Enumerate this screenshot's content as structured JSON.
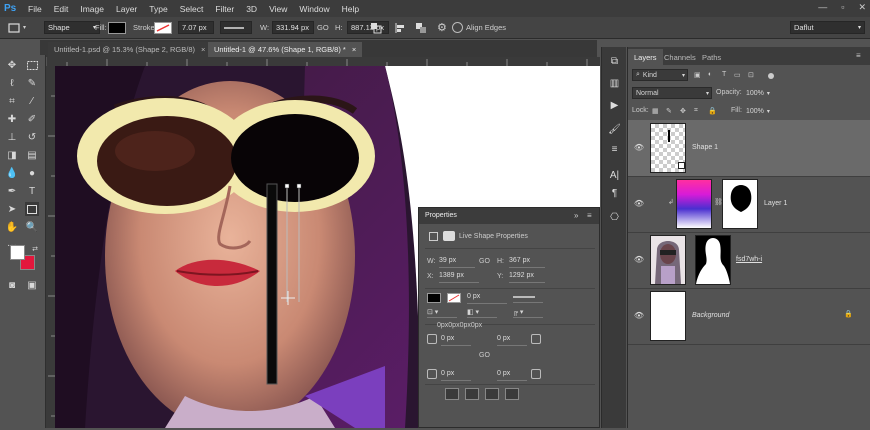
{
  "menu": {
    "logo": "Ps",
    "items": [
      "File",
      "Edit",
      "Image",
      "Layer",
      "Type",
      "Select",
      "Filter",
      "3D",
      "View",
      "Window",
      "Help"
    ],
    "window_controls": [
      "—",
      "▫",
      "✕"
    ]
  },
  "options_bar": {
    "mode": "Shape",
    "fill_label": "Fill:",
    "stroke_label": "Stroke:",
    "stroke_width": "7.07 px",
    "w_label": "W:",
    "w_value": "331.94 px",
    "link_icon": "GO",
    "h_label": "H:",
    "h_value": "887.13 px",
    "align_edges": "Align Edges",
    "workspace": "Daflut",
    "fill_color": "#000000",
    "stroke_color": "#ffffff"
  },
  "tabs": [
    {
      "label": "Untitled-1.psd @ 15.3% (Shape 2, RGB/8)",
      "close": "×"
    },
    {
      "label": "Untitled-1 @ 47.6% (Shape 1, RGB/8) *",
      "close": "×"
    }
  ],
  "panels": {
    "tabs": [
      "Layers",
      "Channels",
      "Paths"
    ],
    "kind": "Kind",
    "blend_mode": "Normal",
    "opacity_label": "Opacity:",
    "opacity": "100%",
    "lock_label": "Lock:",
    "fill_label": "Fill:",
    "fill": "100%"
  },
  "layers": [
    {
      "name": "Shape 1"
    },
    {
      "name": "Layer 1"
    },
    {
      "name": "fsd7wh-i"
    },
    {
      "name": "Background"
    }
  ],
  "properties": {
    "title": "Properties",
    "subtitle": "Live Shape Properties",
    "w_label": "W:",
    "w": "39 px",
    "h_label": "H:",
    "h": "367 px",
    "x_label": "X:",
    "x": "1389 px",
    "y_label": "Y:",
    "y": "1292 px",
    "stroke_width": "0 px",
    "radii_label": "0px0px0px0px",
    "radius_tl": "0 px",
    "radius_tr": "0 px",
    "radius_bl": "0 px",
    "radius_br": "0 px"
  },
  "colors": {
    "foreground": "#ffffff",
    "background": "#e3173c",
    "chrome_dark": "#3c3c3c",
    "panel": "#535353",
    "selected_layer": "#6a6a6a"
  }
}
